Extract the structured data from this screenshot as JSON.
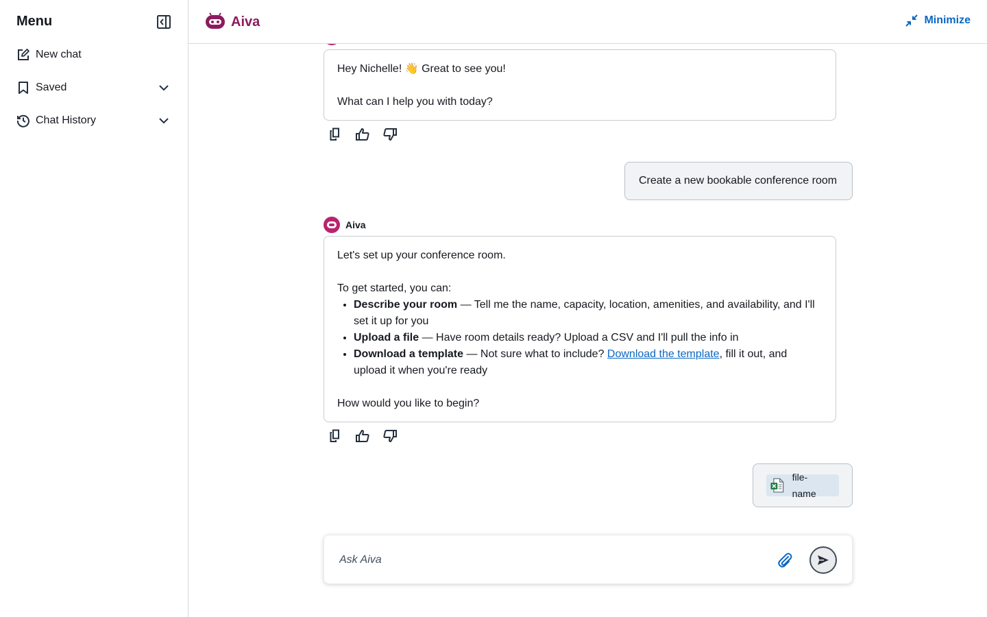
{
  "sidebar": {
    "title": "Menu",
    "items": [
      {
        "label": "New chat",
        "icon": "edit-icon"
      },
      {
        "label": "Saved",
        "icon": "bookmark-icon"
      },
      {
        "label": "Chat History",
        "icon": "history-icon"
      }
    ]
  },
  "header": {
    "app_name": "Aiva",
    "minimize_label": "Minimize"
  },
  "colors": {
    "brand": "#8c1b5e",
    "link": "#0a67c2"
  },
  "messages": {
    "greeting": {
      "line1": "Hey Nichelle! 👋 Great to see you!",
      "line2": "What can I help you with today?"
    },
    "user_request": "Create a new bookable conference room",
    "assistant": {
      "sender": "Aiva",
      "intro": "Let's set up your conference room.",
      "lead": "To get started, you can:",
      "options": [
        {
          "title": "Describe your room",
          "text": " — Tell me the name, capacity, location, amenities, and availability, and I'll set it up for you"
        },
        {
          "title": "Upload a file",
          "text": " — Have room details ready? Upload a CSV and I'll pull the info in"
        },
        {
          "title": "Download a template",
          "text_before": " — Not sure what to include? ",
          "link": "Download the template",
          "text_after": ", fill it out, and upload it when you're ready"
        }
      ],
      "closing": "How would you like to begin?"
    },
    "user_file": {
      "name": "file-name",
      "icon": "excel-file-icon"
    }
  },
  "composer": {
    "placeholder": "Ask Aiva"
  }
}
